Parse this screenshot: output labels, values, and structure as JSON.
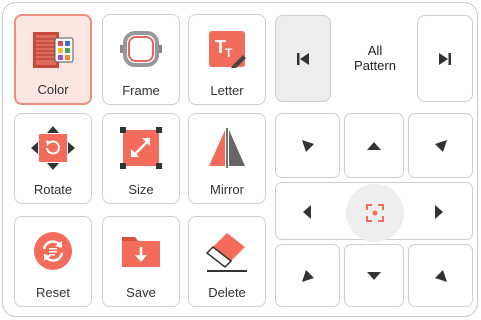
{
  "tools": {
    "color": "Color",
    "frame": "Frame",
    "letter": "Letter",
    "rotate": "Rotate",
    "size": "Size",
    "mirror": "Mirror",
    "reset": "Reset",
    "save": "Save",
    "delete": "Delete"
  },
  "pattern": {
    "line1": "All",
    "line2": "Pattern"
  },
  "icons": {
    "color": "thread-spool-palette-icon",
    "frame": "embroidery-hoop-icon",
    "letter": "letter-edit-icon",
    "rotate": "rotate-icon",
    "size": "resize-icon",
    "mirror": "mirror-icon",
    "reset": "reset-icon",
    "save": "save-folder-icon",
    "delete": "eraser-icon",
    "prev": "skip-previous-icon",
    "next": "skip-next-icon",
    "center": "focus-center-icon"
  },
  "colors": {
    "accent": "#f26b5b",
    "accent_light": "#fbe6e2",
    "selected_border": "#f08c80",
    "arrow": "#333333"
  }
}
